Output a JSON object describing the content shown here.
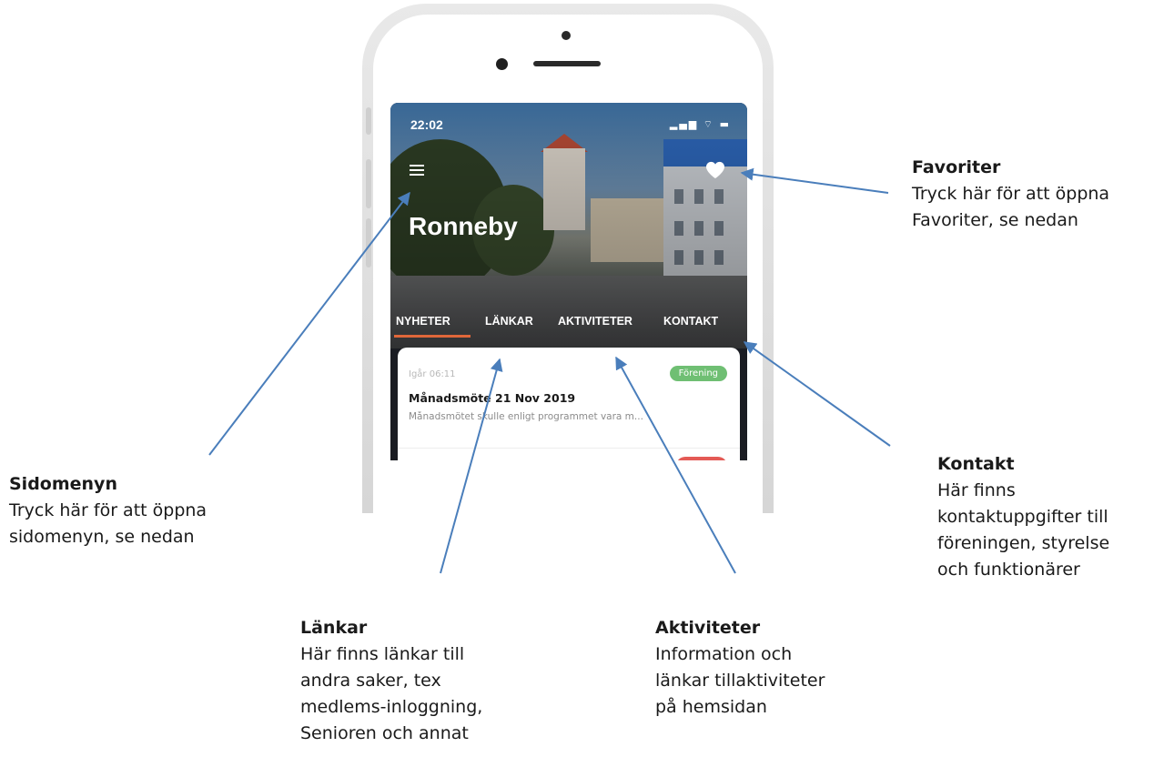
{
  "phone": {
    "status_time": "22:02",
    "status_icons": "signal-wifi-battery",
    "city_title": "Ronneby",
    "tabs": [
      {
        "label": "NYHETER",
        "active": true
      },
      {
        "label": "LÄNKAR",
        "active": false
      },
      {
        "label": "AKTIVITETER",
        "active": false
      },
      {
        "label": "KONTAKT",
        "active": false
      }
    ],
    "card": {
      "time": "Igår 06:11",
      "badge": "Förening",
      "title": "Månadsmöte 21 Nov 2019",
      "excerpt": "Månadsmötet skulle enligt programmet vara m..."
    }
  },
  "annotations": {
    "favoriter": {
      "heading": "Favoriter",
      "body": "Tryck här för att öppna\nFavoriter, se nedan"
    },
    "sidomenyn": {
      "heading": "Sidomenyn",
      "body": "Tryck här för att öppna\nsidomenyn, se nedan"
    },
    "kontakt": {
      "heading": "Kontakt",
      "body": "Här finns\nkontaktuppgifter till\nföreningen, styrelse\noch funktionärer"
    },
    "lankar": {
      "heading": "Länkar",
      "body": "Här finns länkar till\nandra saker, tex\nmedlems-inloggning,\nSenioren och annat"
    },
    "aktiviteter": {
      "heading": "Aktiviteter",
      "body": "Information och\nlänkar tillaktiviteter\npå hemsidan"
    }
  },
  "colors": {
    "arrow": "#4a7ebb",
    "tab_underline": "#e0673a",
    "badge_green": "#6fbf73",
    "badge_red": "#e45a55"
  }
}
